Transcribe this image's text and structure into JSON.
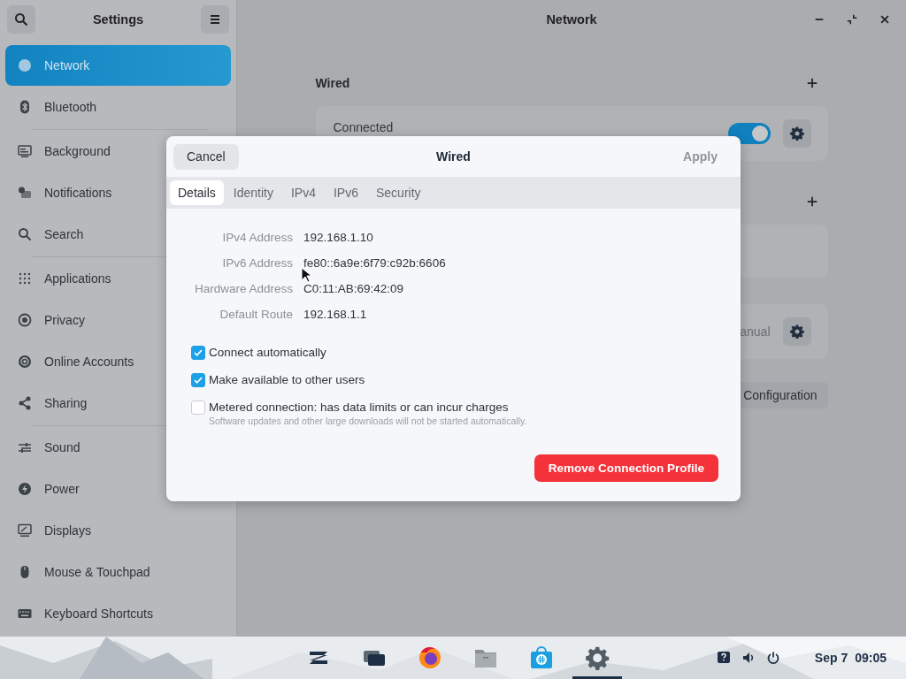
{
  "sidebar": {
    "title": "Settings",
    "groups": [
      [
        {
          "label": "Network",
          "selected": true
        },
        {
          "label": "Bluetooth",
          "selected": false
        }
      ],
      [
        {
          "label": "Background",
          "selected": false
        },
        {
          "label": "Notifications",
          "selected": false
        },
        {
          "label": "Search",
          "selected": false
        }
      ],
      [
        {
          "label": "Applications",
          "selected": false
        },
        {
          "label": "Privacy",
          "selected": false
        },
        {
          "label": "Online Accounts",
          "selected": false
        },
        {
          "label": "Sharing",
          "selected": false
        }
      ],
      [
        {
          "label": "Sound",
          "selected": false
        },
        {
          "label": "Power",
          "selected": false
        },
        {
          "label": "Displays",
          "selected": false
        },
        {
          "label": "Mouse & Touchpad",
          "selected": false
        },
        {
          "label": "Keyboard Shortcuts",
          "selected": false
        }
      ]
    ]
  },
  "main": {
    "title": "Network",
    "sections": [
      {
        "heading": "Wired",
        "cards": [
          {
            "kind": "toggle",
            "label": "Connected",
            "on": true
          }
        ]
      },
      {
        "cards": [
          {
            "kind": "blank"
          },
          {
            "kind": "setting",
            "label": "anual"
          }
        ]
      }
    ],
    "button": "Configuration"
  },
  "dialog": {
    "title": "Wired",
    "cancel": "Cancel",
    "apply": "Apply",
    "apply_disabled": true,
    "tabs": [
      {
        "label": "Details",
        "selected": true
      },
      {
        "label": "Identity",
        "selected": false
      },
      {
        "label": "IPv4",
        "selected": false
      },
      {
        "label": "IPv6",
        "selected": false
      },
      {
        "label": "Security",
        "selected": false
      }
    ],
    "details": [
      {
        "label": "IPv4 Address",
        "value": "192.168.1.10"
      },
      {
        "label": "IPv6 Address",
        "value": "fe80::6a9e:6f79:c92b:6606"
      },
      {
        "label": "Hardware Address",
        "value": "C0:11:AB:69:42:09"
      },
      {
        "label": "Default Route",
        "value": "192.168.1.1"
      }
    ],
    "options": [
      {
        "label": "Connect automatically",
        "checked": true
      },
      {
        "label": "Make available to other users",
        "checked": true
      },
      {
        "label": "Metered connection: has data limits or can incur charges",
        "hint": "Software updates and other large downloads will not be started automatically.",
        "checked": false
      }
    ],
    "remove": "Remove Connection Profile"
  },
  "taskbar": {
    "apps": [
      {
        "selected": false
      },
      {
        "selected": false
      },
      {
        "selected": false
      },
      {
        "selected": false
      },
      {
        "selected": false
      },
      {
        "selected": true
      }
    ],
    "date": "Sep 7",
    "time": "09:05"
  }
}
